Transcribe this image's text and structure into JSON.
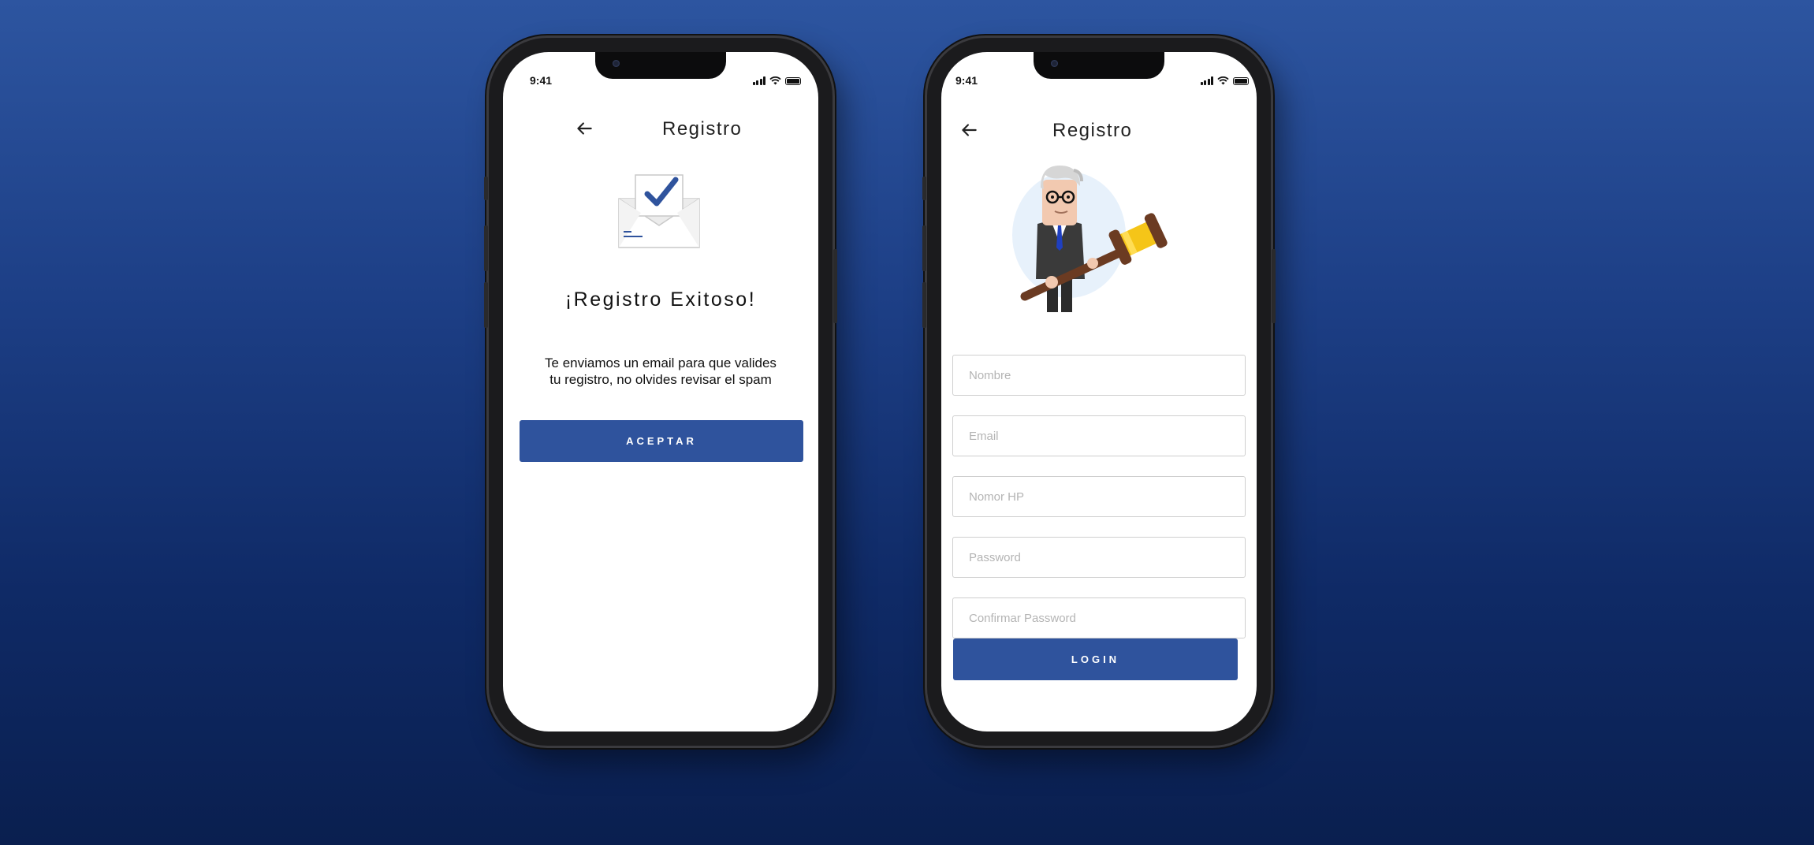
{
  "status_bar": {
    "time": "9:41"
  },
  "screen_success": {
    "title": "Registro",
    "heading": "¡Registro Exitoso!",
    "message_line1": "Te enviamos un email para que valides",
    "message_line2": "tu registro, no olvides revisar el spam",
    "accept_button": "ACEPTAR"
  },
  "screen_register": {
    "title": "Registro",
    "fields": {
      "name_placeholder": "Nombre",
      "email_placeholder": "Email",
      "phone_placeholder": "Nomor HP",
      "password_placeholder": "Password",
      "confirm_placeholder": "Confirmar Password"
    },
    "login_button": "LOGIN"
  },
  "colors": {
    "primary": "#2f539d",
    "background_top": "#2d55a0",
    "background_bottom": "#0a1f4f"
  }
}
